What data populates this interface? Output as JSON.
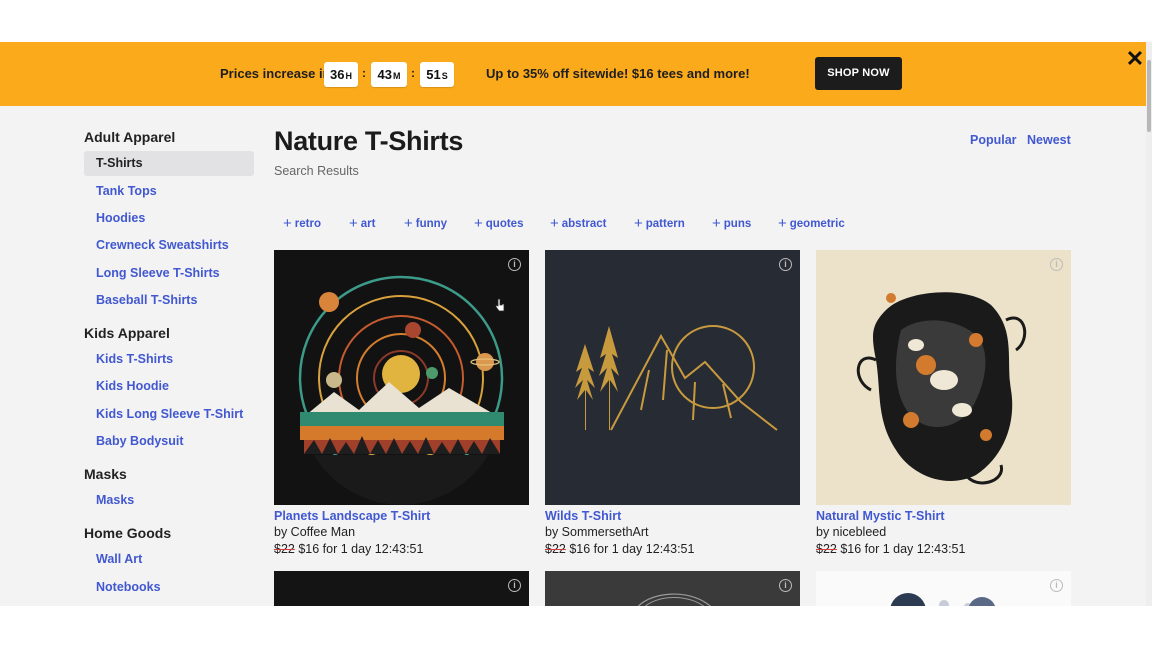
{
  "promo": {
    "prefix": "Prices increase in",
    "hours": "36",
    "hours_unit": "H",
    "minutes": "43",
    "minutes_unit": "M",
    "seconds": "51",
    "seconds_unit": "S",
    "separator": ":",
    "offer": "Up to 35% off sitewide! $16 tees and more!",
    "cta": "SHOP NOW",
    "close_icon": "close-icon",
    "close_glyph": "✕",
    "bg_color": "#fbaa1b"
  },
  "sidebar": {
    "adult": {
      "heading": "Adult Apparel",
      "active": "T-Shirts",
      "items": [
        "Tank Tops",
        "Hoodies",
        "Crewneck Sweatshirts",
        "Long Sleeve T-Shirts",
        "Baseball T-Shirts"
      ]
    },
    "kids": {
      "heading": "Kids Apparel",
      "items": [
        "Kids T-Shirts",
        "Kids Hoodie",
        "Kids Long Sleeve T-Shirt",
        "Baby Bodysuit"
      ]
    },
    "masks": {
      "heading": "Masks",
      "items": [
        "Masks"
      ]
    },
    "home": {
      "heading": "Home Goods",
      "items": [
        "Wall Art",
        "Notebooks"
      ]
    }
  },
  "main": {
    "title": "Nature T-Shirts",
    "subtitle": "Search Results",
    "sort": [
      "Popular",
      "Newest"
    ],
    "tags": [
      "retro",
      "art",
      "funny",
      "quotes",
      "abstract",
      "pattern",
      "puns",
      "geometric"
    ],
    "tag_prefix": "+",
    "info_glyph": "i",
    "products": [
      {
        "title": "Planets Landscape T-Shirt",
        "by": "by Coffee Man",
        "old_price": "$22",
        "price": "$16 for 1 day 12:43:51"
      },
      {
        "title": "Wilds T-Shirt",
        "by": "by SommersethArt",
        "old_price": "$22",
        "price": "$16 for 1 day 12:43:51"
      },
      {
        "title": "Natural Mystic T-Shirt",
        "by": "by nicebleed",
        "old_price": "$22",
        "price": "$16 for 1 day 12:43:51"
      }
    ]
  },
  "colors": {
    "link": "#4158d0",
    "accent": "#fbaa1b",
    "strike": "#d63b3b"
  }
}
